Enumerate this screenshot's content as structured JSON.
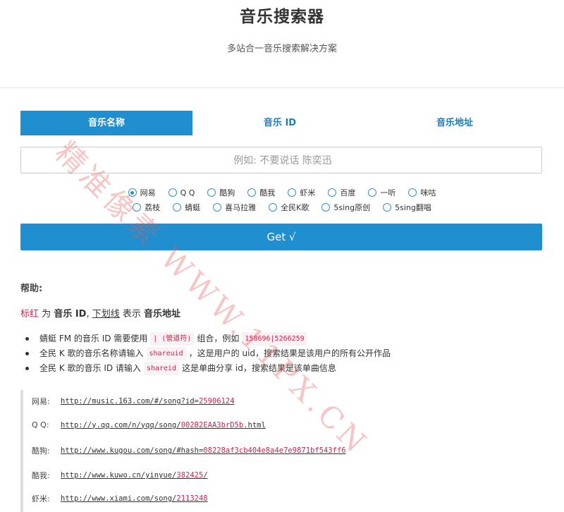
{
  "header": {
    "title": "音乐搜索器",
    "subtitle": "多站合一音乐搜索解决方案"
  },
  "tabs": [
    {
      "label": "音乐名称",
      "active": true
    },
    {
      "label": "音乐 ID",
      "active": false
    },
    {
      "label": "音乐地址",
      "active": false
    }
  ],
  "search": {
    "placeholder": "例如: 不要说话 陈奕迅",
    "value": ""
  },
  "sources": {
    "selected": "网易",
    "row1": [
      "网易",
      "Q Q",
      "酷狗",
      "酷我",
      "虾米",
      "百度",
      "一听",
      "咪咕"
    ],
    "row2": [
      "荔枝",
      "蜻蜓",
      "喜马拉雅",
      "全民K歌",
      "5sing原创",
      "5sing翻唱"
    ]
  },
  "get_button": {
    "label": "Get √"
  },
  "help": {
    "heading": "帮助:",
    "legend": {
      "red": "标红",
      "is": "为",
      "id": "音乐 ID",
      "underline": "下划线",
      "means": "表示",
      "url": "音乐地址"
    },
    "items": [
      {
        "before": "蜻蜓 FM 的音乐 ID 需要使用",
        "code": "| (管道符)",
        "middle": "组合，例如",
        "code2": "158696|5266259",
        "after": ""
      },
      {
        "before": "全民 K 歌的音乐名称请输入",
        "code": "shareuid",
        "middle": "，这是用户的 uid，搜索结果是该用户的所有公开作品",
        "code2": "",
        "after": ""
      },
      {
        "before": "全民 K 歌的音乐 ID 请输入",
        "code": "shareid",
        "middle": "这是单曲分享 id，搜索结果是该单曲信息",
        "code2": "",
        "after": ""
      }
    ]
  },
  "examples": [
    {
      "label": "网易:",
      "url": "http://music.163.com/#/song?id=",
      "id": "25906124"
    },
    {
      "label": "Q Q:",
      "url": "http://y.qq.com/n/yqq/song/",
      "id": "002B2EAA3brD5b",
      "suffix": ".html"
    },
    {
      "label": "酷狗:",
      "url": "http://www.kugou.com/song/#hash=",
      "id": "08228af3cb404e8a4e7e9871bf543ff6"
    },
    {
      "label": "酷我:",
      "url": "http://www.kuwo.cn/yinyue/",
      "id": "382425",
      "suffix": "/"
    },
    {
      "label": "虾米:",
      "url": "http://www.xiami.com/song/",
      "id": "2113248"
    }
  ],
  "watermark": "精准像素 WWW.11PX.CN",
  "colors": {
    "primary": "#1f8fcf",
    "red": "#c7254e",
    "watermark": "#e65a5a"
  }
}
